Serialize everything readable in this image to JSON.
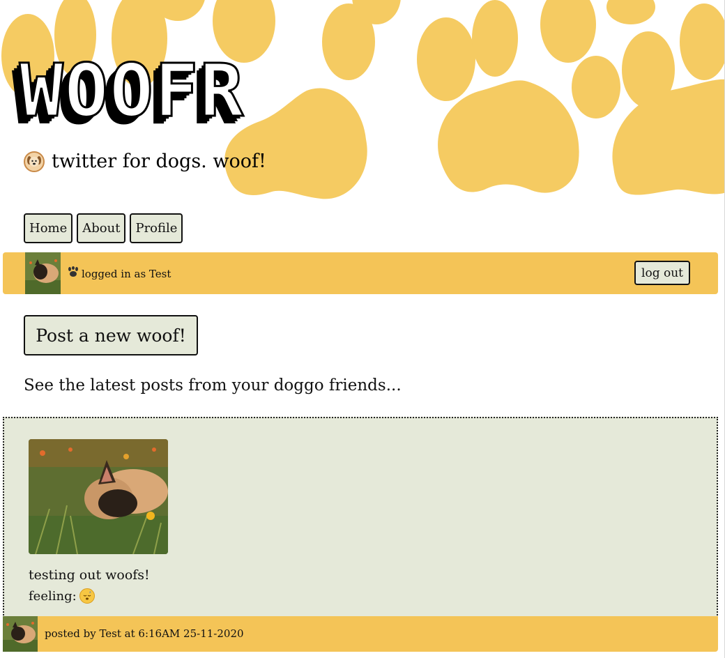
{
  "header": {
    "logo_text": "WOOFR",
    "tagline": "twitter for dogs. woof!",
    "tagline_icon": "dog-face-icon"
  },
  "nav": {
    "items": [
      {
        "label": "Home"
      },
      {
        "label": "About"
      },
      {
        "label": "Profile"
      }
    ]
  },
  "user_bar": {
    "logged_in_text": "logged in as Test",
    "logout_label": "log out",
    "icon": "paw-icon"
  },
  "actions": {
    "post_label": "Post a new woof!"
  },
  "feed": {
    "intro": "See the latest posts from your doggo friends...",
    "posts": [
      {
        "text": "testing out woofs!",
        "feeling_label": "feeling:",
        "feeling_icon": "sleeping-face-icon",
        "footer": "posted by Test at 6:16AM 25-11-2020"
      }
    ]
  },
  "colors": {
    "paw": "#f5cb62",
    "bar": "#f4c457",
    "card": "#e5e9d9"
  }
}
